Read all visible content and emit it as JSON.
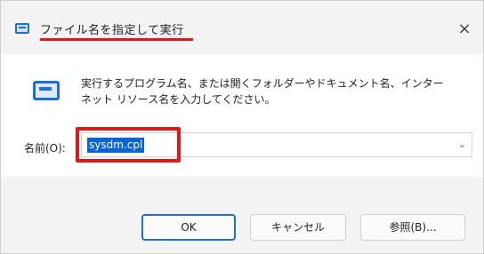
{
  "window": {
    "title": "ファイル名を指定して実行",
    "close_symbol": "×",
    "icon": "run-dialog-icon"
  },
  "content": {
    "description_line1": "実行するプログラム名、または開くフォルダーやドキュメント名、インター",
    "description_line2": "ネット リソース名を入力してください。",
    "open_label": "名前(O):",
    "input_value": "sysdm.cpl",
    "dropdown_symbol": "⌄"
  },
  "buttons": {
    "ok": "OK",
    "cancel": "キャンセル",
    "browse": "参照(B)..."
  },
  "colors": {
    "accent": "#1e6fd0",
    "highlight_red": "#e01818",
    "selection": "#0a64d8"
  }
}
